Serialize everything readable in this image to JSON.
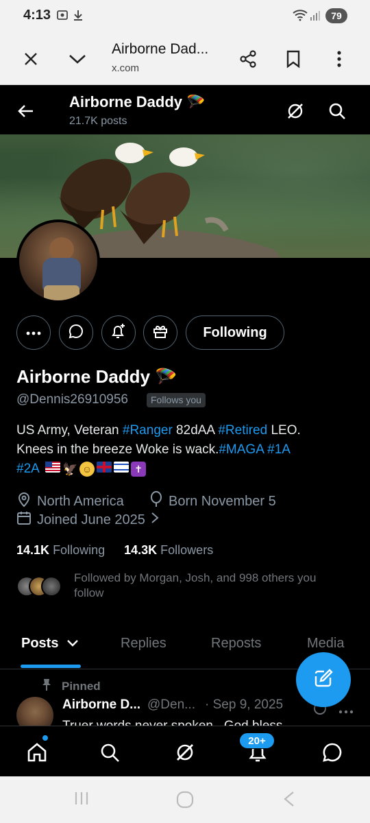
{
  "status": {
    "time": "4:13",
    "battery": "79"
  },
  "browser": {
    "page_title": "Airborne Dad...",
    "url": "x.com"
  },
  "header": {
    "name": "Airborne Daddy 🪂",
    "posts": "21.7K posts"
  },
  "actions": {
    "follow_label": "Following"
  },
  "profile": {
    "name": "Airborne Daddy 🪂",
    "handle": "@Dennis26910956",
    "follows_you": "Follows you",
    "bio": {
      "line1_a": "US Army, Veteran ",
      "tag_ranger": "#Ranger",
      "line1_b": " 82dAA ",
      "tag_retired": "#Retired",
      "line1_c": " LEO.",
      "line2_a": "Knees in the breeze  Woke is wack.",
      "tag_maga": "#MAGA",
      "tag_1a": "#1A",
      "tag_2a": "#2A"
    },
    "location": "North America",
    "birthday": "Born November 5",
    "joined": "Joined June 2025",
    "following_count": "14.1K",
    "following_label": "Following",
    "followers_count": "14.3K",
    "followers_label": "Followers",
    "followed_by": "Followed by Morgan, Josh, and 998 others you follow"
  },
  "tabs": [
    {
      "label": "Posts",
      "active": true
    },
    {
      "label": "Replies",
      "active": false
    },
    {
      "label": "Reposts",
      "active": false
    },
    {
      "label": "Media",
      "active": false
    }
  ],
  "pinned_post": {
    "pinned_label": "Pinned",
    "author": "Airborne D...",
    "handle": "@Den...",
    "date": "· Sep 9, 2025",
    "text": "Truer words never spoken . God bless"
  },
  "bottom_nav": {
    "notifications_badge": "20+"
  },
  "colors": {
    "accent": "#1d9bf0",
    "background": "#000000",
    "muted": "#71767b"
  },
  "icons": [
    "close-icon",
    "chevron-down-icon",
    "share-icon",
    "bookmark-icon",
    "more-vertical-icon",
    "back-arrow-icon",
    "grok-icon",
    "search-icon",
    "more-horizontal-icon",
    "message-icon",
    "notification-add-icon",
    "gift-icon",
    "location-icon",
    "balloon-icon",
    "calendar-icon",
    "compose-icon",
    "home-icon",
    "bell-icon",
    "pin-icon"
  ]
}
